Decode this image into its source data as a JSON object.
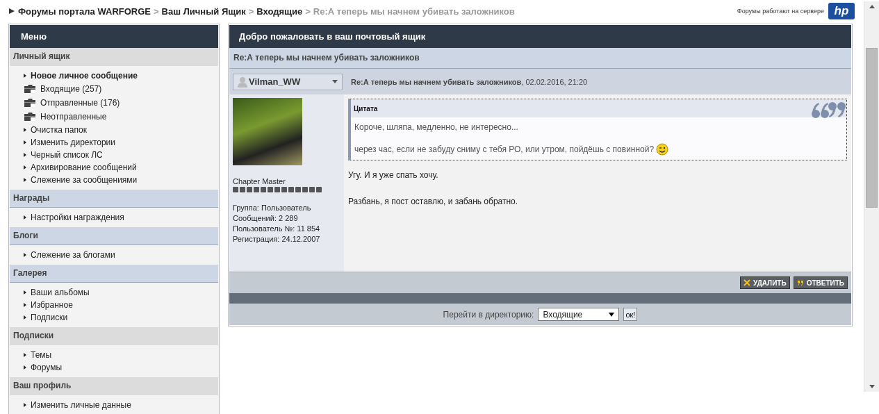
{
  "breadcrumb": [
    {
      "label": "Форумы портала WARFORGE",
      "current": false
    },
    {
      "separator": ">",
      "label": "Ваш Личный Ящик",
      "current": false
    },
    {
      "separator": ">",
      "label": "Входящие",
      "current": false
    },
    {
      "separator": ">",
      "label": "Re:А теперь мы начнем убивать заложников",
      "current": true
    }
  ],
  "server_note": "Форумы работают на сервере",
  "logo_text": "hp",
  "sidebar": {
    "title": "Меню",
    "sections": [
      {
        "heading": "Личный ящик",
        "highlighted": false,
        "items": [
          {
            "label": "Новое личное сообщение",
            "kind": "link",
            "bold": true
          },
          {
            "label": "Входящие (257)",
            "kind": "folder",
            "bold": false
          },
          {
            "label": "Отправленные (176)",
            "kind": "folder",
            "bold": false
          },
          {
            "label": "Неотправленные",
            "kind": "folder",
            "bold": false
          },
          {
            "label": "Очистка папок",
            "kind": "link",
            "bold": false
          },
          {
            "label": "Изменить директории",
            "kind": "link",
            "bold": false
          },
          {
            "label": "Черный список ЛС",
            "kind": "link",
            "bold": false
          },
          {
            "label": "Архивирование сообщений",
            "kind": "link",
            "bold": false
          },
          {
            "label": "Слежение за сообщениями",
            "kind": "link",
            "bold": false
          }
        ]
      },
      {
        "heading": "Награды",
        "highlighted": true,
        "items": [
          {
            "label": "Настройки награждения",
            "kind": "link",
            "bold": false
          }
        ]
      },
      {
        "heading": "Блоги",
        "highlighted": true,
        "items": [
          {
            "label": "Слежение за блогами",
            "kind": "link",
            "bold": false
          }
        ]
      },
      {
        "heading": "Галерея",
        "highlighted": true,
        "items": [
          {
            "label": "Ваши альбомы",
            "kind": "link",
            "bold": false
          },
          {
            "label": "Избранное",
            "kind": "link",
            "bold": false
          },
          {
            "label": "Подписки",
            "kind": "link",
            "bold": false
          }
        ]
      },
      {
        "heading": "Подписки",
        "highlighted": false,
        "items": [
          {
            "label": "Темы",
            "kind": "link",
            "bold": false
          },
          {
            "label": "Форумы",
            "kind": "link",
            "bold": false
          }
        ]
      },
      {
        "heading": "Ваш профиль",
        "highlighted": false,
        "items": [
          {
            "label": "Изменить личные данные",
            "kind": "link",
            "bold": false
          }
        ]
      }
    ]
  },
  "main": {
    "title": "Добро пожаловать в ваш почтовый ящик",
    "subject": "Re:А теперь мы начнем убивать заложников",
    "post": {
      "author": "Vilman_WW",
      "post_title": "Re:А теперь мы начнем убивать заложников",
      "date": ", 02.02.2016, 21:20",
      "rank": "Chapter Master",
      "info": [
        "Группа: Пользователь",
        "Сообщений: 2 289",
        "Пользователь №: 11 854",
        "Регистрация: 24.12.2007"
      ],
      "quote": {
        "label": "Цитата",
        "lines": [
          "Короче, шляпа, медленно, не интересно...",
          "через час, если не забуду сниму с тебя РО, или утром, пойдёшь с повинной?"
        ]
      },
      "paragraphs": [
        "Угу. И я уже спать хочу.",
        "Разбань, я пост оставлю, и забань обратно."
      ]
    },
    "buttons": [
      {
        "label": "УДАЛИТЬ",
        "kind": "delete"
      },
      {
        "label": "ОТВЕТИТЬ",
        "kind": "reply"
      }
    ],
    "jump": {
      "label": "Перейти в директорию:",
      "value": "Входящие",
      "button": "ок!"
    }
  }
}
